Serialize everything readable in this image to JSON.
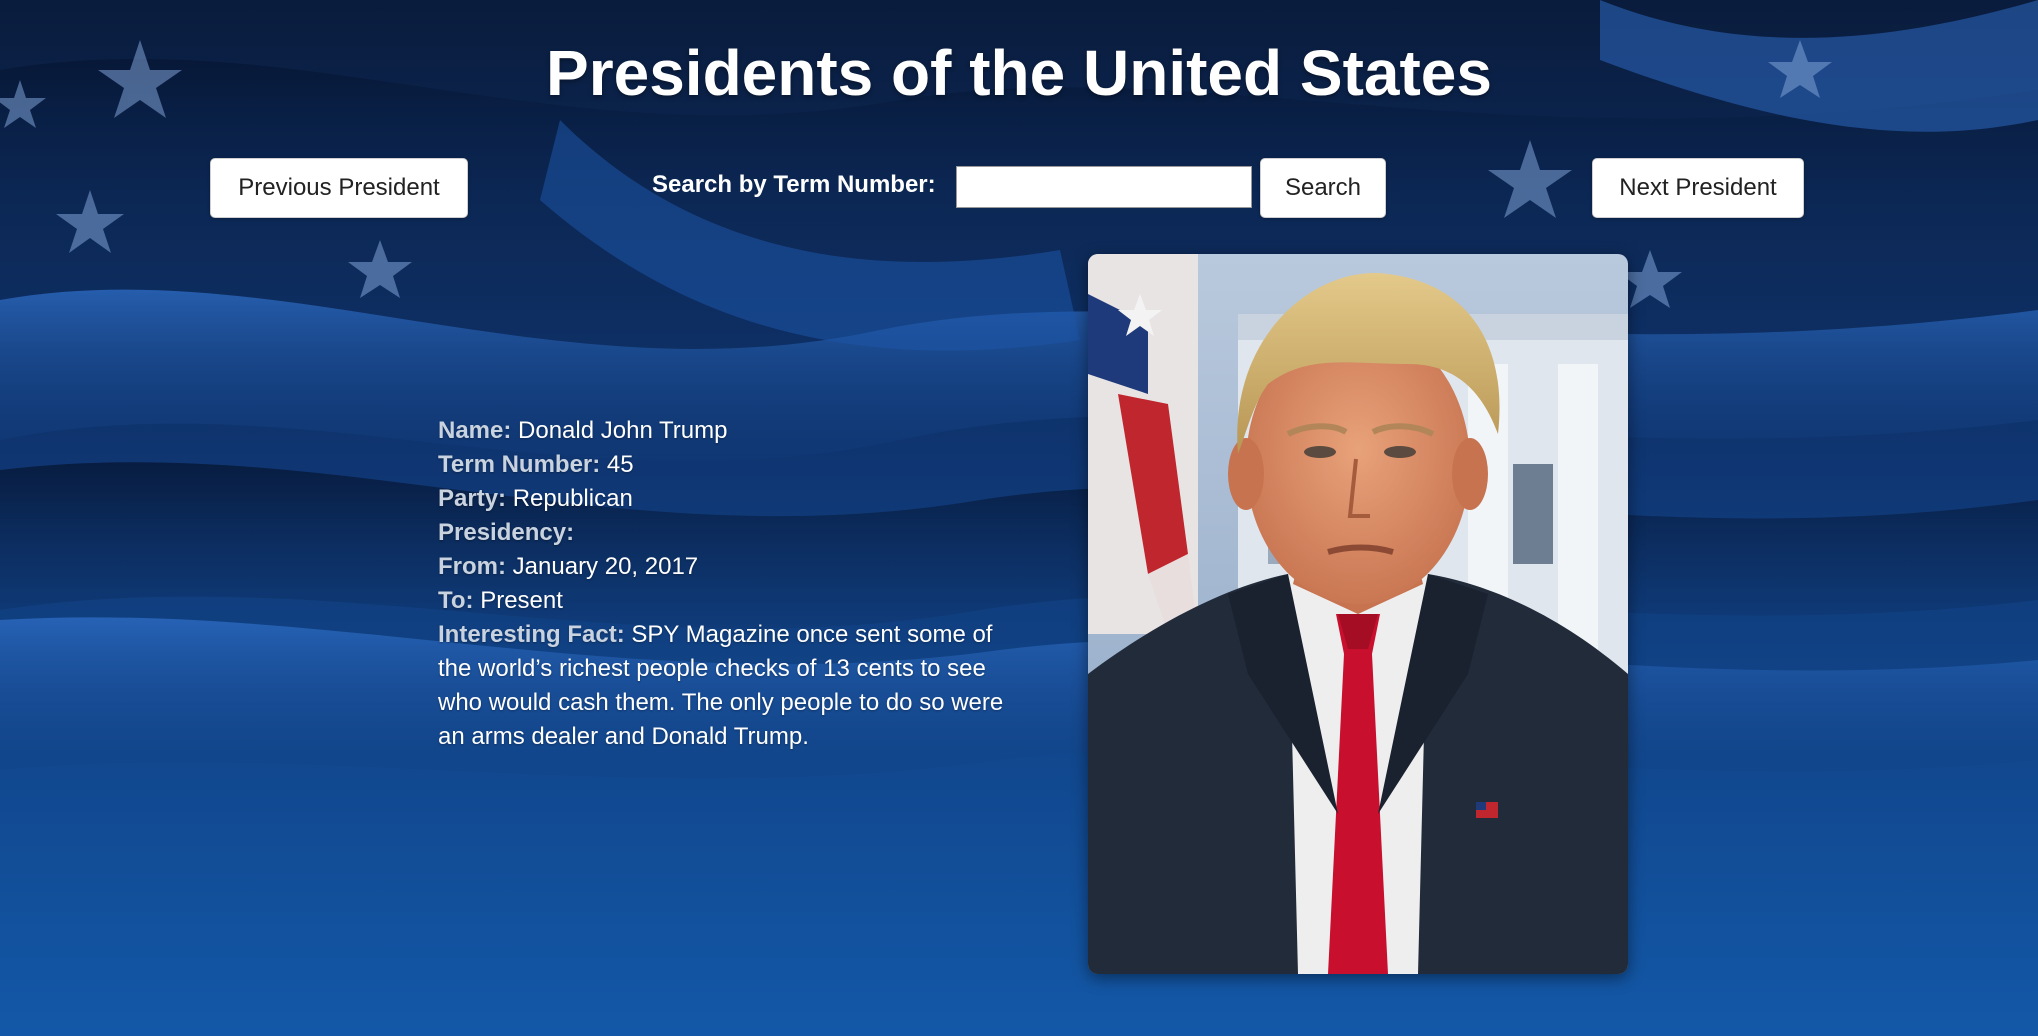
{
  "header": {
    "title": "Presidents of the United States"
  },
  "nav": {
    "previous_label": "Previous President",
    "next_label": "Next President",
    "search_label": "Search by Term Number:",
    "search_value": "",
    "search_placeholder": "",
    "search_button_label": "Search"
  },
  "president": {
    "name_label": "Name:",
    "name": "Donald John Trump",
    "term_label": "Term Number:",
    "term": "45",
    "party_label": "Party:",
    "party": "Republican",
    "presidency_label": "Presidency:",
    "from_label": "From:",
    "from": "January 20, 2017",
    "to_label": "To:",
    "to": "Present",
    "fact_label": "Interesting Fact:",
    "fact": "SPY Magazine once sent some of the world’s richest people checks of 13 cents to see who would cash them. The only people to do so were an arms dealer and Donald Trump."
  },
  "colors": {
    "background_blue": "#0e3f85",
    "label_gray": "#c9d2df",
    "button_bg": "#ffffff"
  }
}
